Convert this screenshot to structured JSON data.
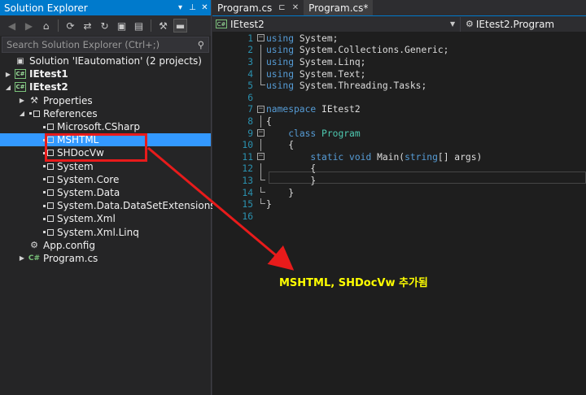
{
  "solution_explorer": {
    "title": "Solution Explorer",
    "title_icons": [
      "pin-icon",
      "auto-hide-icon",
      "close-icon"
    ],
    "search_placeholder": "Search Solution Explorer (Ctrl+;)",
    "tree": [
      {
        "label": "Solution 'IEautomation' (2 projects)",
        "indent": 0,
        "expander": "",
        "icon": "solution-icon"
      },
      {
        "label": "IEtest1",
        "indent": 0,
        "expander": "▶",
        "icon": "csharp-project-icon",
        "bold": true
      },
      {
        "label": "IEtest2",
        "indent": 0,
        "expander": "◢",
        "icon": "csharp-project-icon",
        "bold": true
      },
      {
        "label": "Properties",
        "indent": 1,
        "expander": "▶",
        "icon": "wrench-icon"
      },
      {
        "label": "References",
        "indent": 1,
        "expander": "◢",
        "icon": "reference-icon"
      },
      {
        "label": "Microsoft.CSharp",
        "indent": 2,
        "expander": "",
        "icon": "reference-icon"
      },
      {
        "label": "MSHTML",
        "indent": 2,
        "expander": "",
        "icon": "reference-icon",
        "selected": true
      },
      {
        "label": "SHDocVw",
        "indent": 2,
        "expander": "",
        "icon": "reference-icon"
      },
      {
        "label": "System",
        "indent": 2,
        "expander": "",
        "icon": "reference-icon"
      },
      {
        "label": "System.Core",
        "indent": 2,
        "expander": "",
        "icon": "reference-icon"
      },
      {
        "label": "System.Data",
        "indent": 2,
        "expander": "",
        "icon": "reference-icon"
      },
      {
        "label": "System.Data.DataSetExtensions",
        "indent": 2,
        "expander": "",
        "icon": "reference-icon"
      },
      {
        "label": "System.Xml",
        "indent": 2,
        "expander": "",
        "icon": "reference-icon"
      },
      {
        "label": "System.Xml.Linq",
        "indent": 2,
        "expander": "",
        "icon": "reference-icon"
      },
      {
        "label": "App.config",
        "indent": 1,
        "expander": "",
        "icon": "config-file-icon"
      },
      {
        "label": "Program.cs",
        "indent": 1,
        "expander": "▶",
        "icon": "csharp-file-icon"
      }
    ]
  },
  "tabs": [
    {
      "label": "Program.cs",
      "active": false
    },
    {
      "label": "Program.cs*",
      "active": true
    }
  ],
  "navbar": {
    "project": "IEtest2",
    "member": "IEtest2.Program"
  },
  "code": [
    [
      {
        "t": "using",
        "c": "kw"
      },
      {
        "t": " System;",
        "c": "txt"
      }
    ],
    [
      {
        "t": "using",
        "c": "kw"
      },
      {
        "t": " System.Collections.Generic;",
        "c": "txt"
      }
    ],
    [
      {
        "t": "using",
        "c": "kw"
      },
      {
        "t": " System.Linq;",
        "c": "txt"
      }
    ],
    [
      {
        "t": "using",
        "c": "kw"
      },
      {
        "t": " System.Text;",
        "c": "txt"
      }
    ],
    [
      {
        "t": "using",
        "c": "kw"
      },
      {
        "t": " System.Threading.Tasks;",
        "c": "txt"
      }
    ],
    [],
    [
      {
        "t": "namespace",
        "c": "kw"
      },
      {
        "t": " IEtest2",
        "c": "txt"
      }
    ],
    [
      {
        "t": "{",
        "c": "txt"
      }
    ],
    [
      {
        "t": "    ",
        "c": "txt"
      },
      {
        "t": "class",
        "c": "kw"
      },
      {
        "t": " ",
        "c": "txt"
      },
      {
        "t": "Program",
        "c": "ty"
      }
    ],
    [
      {
        "t": "    {",
        "c": "txt"
      }
    ],
    [
      {
        "t": "        ",
        "c": "txt"
      },
      {
        "t": "static",
        "c": "kw"
      },
      {
        "t": " ",
        "c": "txt"
      },
      {
        "t": "void",
        "c": "kw"
      },
      {
        "t": " Main(",
        "c": "txt"
      },
      {
        "t": "string",
        "c": "kw"
      },
      {
        "t": "[] args)",
        "c": "txt"
      }
    ],
    [
      {
        "t": "        {",
        "c": "txt"
      }
    ],
    [
      {
        "t": "        }",
        "c": "txt"
      }
    ],
    [
      {
        "t": "    }",
        "c": "txt"
      }
    ],
    [
      {
        "t": "}",
        "c": "txt"
      }
    ],
    []
  ],
  "annotation": "MSHTML, SHDocVw 추가됨",
  "colors": {
    "accent": "#007acc",
    "selection": "#3399ff",
    "highlight_box": "#e81b1b",
    "annotation": "#ffff00"
  }
}
